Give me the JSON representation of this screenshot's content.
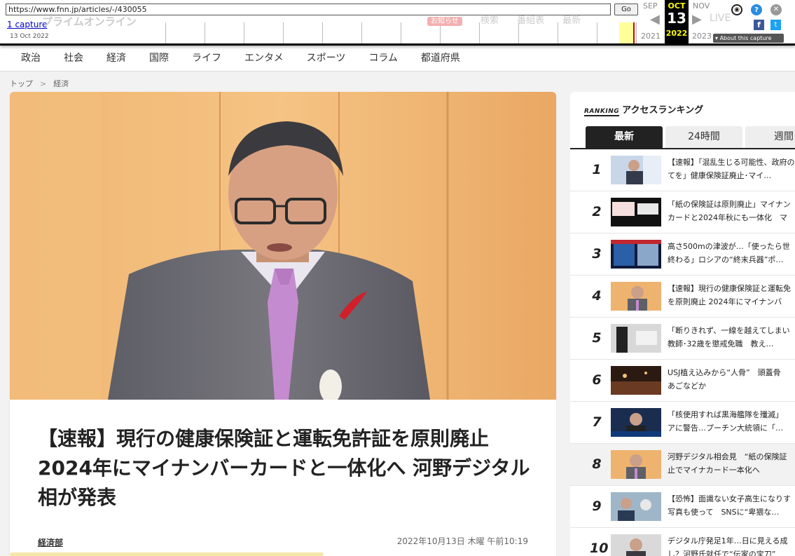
{
  "wayback": {
    "url": "https://www.fnn.jp/articles/-/430055",
    "go_label": "Go",
    "captures_label": "1 capture",
    "capture_date": "13 Oct 2022",
    "prev_month": "SEP",
    "cur_month": "OCT",
    "next_month": "NOV",
    "cur_day": "13",
    "prev_year": "2021",
    "cur_year": "2022",
    "next_year": "2023",
    "live_label": "LIVE",
    "about_label": "About this capture",
    "icons": [
      "user-icon",
      "help-icon",
      "close-icon",
      "facebook-icon",
      "twitter-icon"
    ]
  },
  "site_ghost": {
    "logo": "プライムオンライン",
    "badge": "お知らせ",
    "nav": [
      "検索",
      "番組表",
      "最新"
    ]
  },
  "nav": {
    "items": [
      "政治",
      "社会",
      "経済",
      "国際",
      "ライフ",
      "エンタメ",
      "スポーツ",
      "コラム",
      "都道府県"
    ]
  },
  "breadcrumb": {
    "home": "トップ",
    "sep": ">",
    "current": "経済"
  },
  "article": {
    "headline": "【速報】現行の健康保険証と運転免許証を原則廃止 2024年にマイナンバーカードと一体化へ 河野デジタル相が発表",
    "author": "経済部",
    "published": "2022年10月13日 木曜 午前10:19"
  },
  "ranking": {
    "tag": "RANKING",
    "title": "アクセスランキング",
    "tabs": [
      "最新",
      "24時間",
      "週間"
    ],
    "items": [
      {
        "num": "1",
        "text": "【速報】「混乱生じる可能性、政府の\nてを」健康保険証廃止･マイ…"
      },
      {
        "num": "2",
        "text": "「紙の保険証は原則廃止」マイナン\nカードと2024年秋にも一体化　マ"
      },
      {
        "num": "3",
        "text": "高さ500mの津波が…「使ったら世\n終わる」ロシアの“終末兵器”ポ…"
      },
      {
        "num": "4",
        "text": "【速報】現行の健康保険証と運転免\nを原則廃止 2024年にマイナンバ"
      },
      {
        "num": "5",
        "text": "「断りきれず、一線を越えてしまい\n教師･32歳を懲戒免職　教え…"
      },
      {
        "num": "6",
        "text": "USJ植え込みから“人骨”　頭蓋骨\nあごなどか"
      },
      {
        "num": "7",
        "text": "「核使用すれば黒海艦隊を殲滅」\nアに警告…プーチン大統領に「…"
      },
      {
        "num": "8",
        "text": "河野デジタル相会見　“紙の保険証\n止でマイナカード一本化へ"
      },
      {
        "num": "9",
        "text": "【恐怖】面識ない女子高生になりす\n写真も使って　SNSに“卑猥な…"
      },
      {
        "num": "10",
        "text": "デジタル庁発足1年…日に見える成\nし？河野氏就任で“伝家の宝刀”"
      }
    ]
  }
}
